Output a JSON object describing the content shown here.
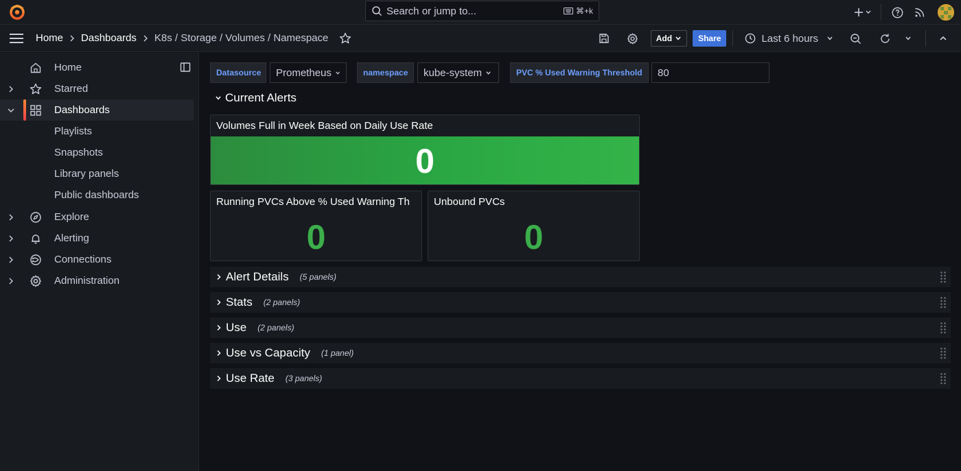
{
  "topbar": {
    "search_placeholder": "Search or jump to...",
    "search_shortcut": "⌘+k"
  },
  "breadcrumb": [
    "Home",
    "Dashboards",
    "K8s / Storage / Volumes / Namespace"
  ],
  "toolbar": {
    "add_label": "Add",
    "share_label": "Share",
    "time_range": "Last 6 hours"
  },
  "sidebar": {
    "items": [
      {
        "label": "Home",
        "icon": "home-icon"
      },
      {
        "label": "Starred",
        "icon": "star-icon"
      },
      {
        "label": "Dashboards",
        "icon": "grid-icon"
      },
      {
        "label": "Playlists"
      },
      {
        "label": "Snapshots"
      },
      {
        "label": "Library panels"
      },
      {
        "label": "Public dashboards"
      },
      {
        "label": "Explore",
        "icon": "compass-icon"
      },
      {
        "label": "Alerting",
        "icon": "bell-icon"
      },
      {
        "label": "Connections",
        "icon": "connections-icon"
      },
      {
        "label": "Administration",
        "icon": "gear-icon"
      }
    ]
  },
  "variables": {
    "datasource_label": "Datasource",
    "datasource_value": "Prometheus",
    "namespace_label": "namespace",
    "namespace_value": "kube-system",
    "threshold_label": "PVC % Used Warning Threshold",
    "threshold_value": "80"
  },
  "current_alerts": {
    "title": "Current Alerts",
    "panels": [
      {
        "title": "Volumes Full in Week Based on Daily Use Rate",
        "value": "0"
      },
      {
        "title": "Running PVCs Above % Used Warning Th",
        "value": "0"
      },
      {
        "title": "Unbound PVCs",
        "value": "0"
      }
    ]
  },
  "rows": [
    {
      "title": "Alert Details",
      "count": "(5 panels)"
    },
    {
      "title": "Stats",
      "count": "(2 panels)"
    },
    {
      "title": "Use",
      "count": "(2 panels)"
    },
    {
      "title": "Use vs Capacity",
      "count": "(1 panel)"
    },
    {
      "title": "Use Rate",
      "count": "(3 panels)"
    }
  ],
  "colors": {
    "accent": "#3d71d9",
    "ok_green": "#3cae4b",
    "active_marker": "#ff8833"
  }
}
